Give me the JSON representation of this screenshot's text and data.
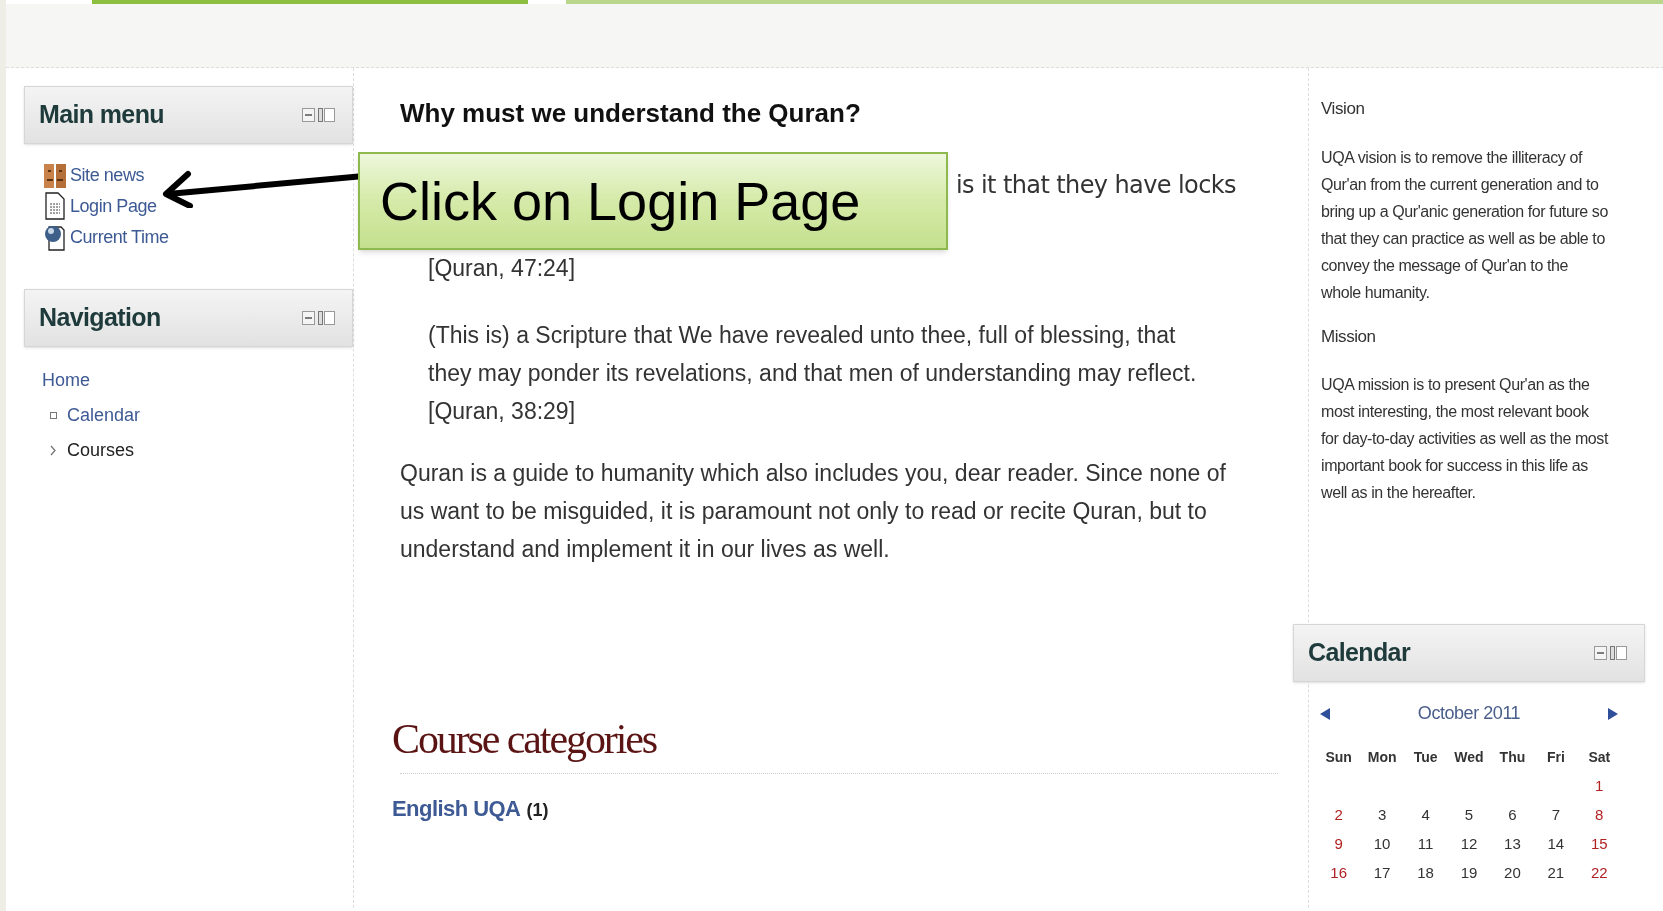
{
  "main_menu": {
    "title": "Main menu",
    "items": [
      {
        "label": "Site news",
        "kind": "forum"
      },
      {
        "label": "Login Page",
        "kind": "page"
      },
      {
        "label": "Current Time",
        "kind": "globe"
      }
    ]
  },
  "navigation": {
    "title": "Navigation",
    "items": [
      {
        "label": "Home",
        "children": [
          {
            "label": "Calendar",
            "kind": "leaf"
          },
          {
            "label": "Courses",
            "kind": "branch"
          }
        ]
      }
    ]
  },
  "article": {
    "heading": "Why must we understand the Quran?",
    "quote_1_fragment": "is it that they have locks",
    "citation_1": "[Quran, 47:24]",
    "quote_2": "(This is) a Scripture that We have revealed unto thee, full of blessing, that they may ponder its revelations, and that men of understanding may reflect.",
    "citation_2": "[Quran, 38:29]",
    "paragraph": "Quran is a guide to humanity which also includes you, dear reader. Since none of us want to be misguided, it is paramount not only to read or recite Quran, but to understand and implement it in our lives as well."
  },
  "course_categories": {
    "title": "Course categories",
    "items": [
      {
        "name": "English UQA",
        "count": "(1)"
      }
    ]
  },
  "about": [
    {
      "heading": "Vision",
      "text": "UQA vision is to remove the illiteracy of Qur'an from the current generation and to bring up a Qur'anic generation for future so that they can practice as well as be able to convey the message of Qur'an to the whole humanity."
    },
    {
      "heading": "Mission",
      "text": "UQA mission is to present Qur'an as the most interesting, the most relevant book for day-to-day activities as well as the most important book for success in this life as well as in the hereafter."
    }
  ],
  "calendar": {
    "title": "Calendar",
    "month": "October 2011",
    "weekdays": [
      "Sun",
      "Mon",
      "Tue",
      "Wed",
      "Thu",
      "Fri",
      "Sat"
    ],
    "weeks": [
      {
        "kind": "leading",
        "days": [
          "1"
        ]
      },
      {
        "kind": "full",
        "days": [
          "2",
          "3",
          "4",
          "5",
          "6",
          "7",
          "8"
        ]
      },
      {
        "kind": "full",
        "days": [
          "9",
          "10",
          "11",
          "12",
          "13",
          "14",
          "15"
        ]
      },
      {
        "kind": "full",
        "days": [
          "16",
          "17",
          "18",
          "19",
          "20",
          "21",
          "22"
        ]
      }
    ]
  },
  "callout": {
    "text": "Click on Login Page"
  }
}
